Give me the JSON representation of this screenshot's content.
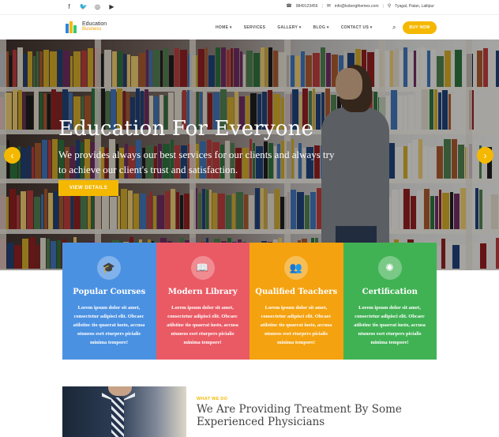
{
  "topbar": {
    "social_icons": [
      "facebook-icon",
      "twitter-icon",
      "instagram-icon",
      "youtube-icon"
    ],
    "social_glyphs": [
      "f",
      "🐦",
      "◎",
      "▶"
    ],
    "phone": "9849123456",
    "email": "info@kobergthemes.com",
    "address": "Tyagal, Patan, Lalitpur"
  },
  "header": {
    "logo_line1": "Education",
    "logo_line2": "Business",
    "nav": [
      "HOME ▾",
      "SERVICES",
      "GALLERY ▾",
      "BLOG ▾",
      "CONTACT US ▾"
    ],
    "buy_label": "BUY NOW"
  },
  "hero": {
    "title": "Education For Everyone",
    "subtitle": "We provides always our best services for our clients and always try to achieve our client's trust and satisfaction.",
    "button": "VIEW DETAILS",
    "prev": "‹",
    "next": "›"
  },
  "features": [
    {
      "title": "Popular Courses",
      "text": "Lorem ipsum dolor sit amet, consectetur adipisci elit. Obcaec atilstinc tio quaerat iusto, accusa ntuneos eset eturpers picialis minima tempore!",
      "color": "#4b91e2",
      "icon": "graduation-cap-icon",
      "glyph": "🎓"
    },
    {
      "title": "Modern Library",
      "text": "Lorem ipsum dolor sit amet, consectetur adipisci elit. Obcaec atilstinc tio quaerat iusto, accusa ntuneos eset eturpers picialis minima tempore!",
      "color": "#ea5a64",
      "icon": "book-icon",
      "glyph": "📖"
    },
    {
      "title": "Qualified Teachers",
      "text": "Lorem ipsum dolor sit amet, consectetur adipisci elit. Obcaec atilstinc tio quaerat iusto, accusa ntuneos eset eturpers picialis minima tempore!",
      "color": "#f4a20f",
      "icon": "users-icon",
      "glyph": "👥"
    },
    {
      "title": "Certification",
      "text": "Lorem ipsum dolor sit amet, consectetur adipisci elit. Obcaec atilstinc tio quaerat iusto, accusa ntuneos eset eturpers picialis minima tempore!",
      "color": "#41b254",
      "icon": "certificate-icon",
      "glyph": "✺"
    }
  ],
  "what": {
    "label": "WHAT WE DO",
    "title": "We Are Providing Treatment By Some Experienced Physicians"
  }
}
